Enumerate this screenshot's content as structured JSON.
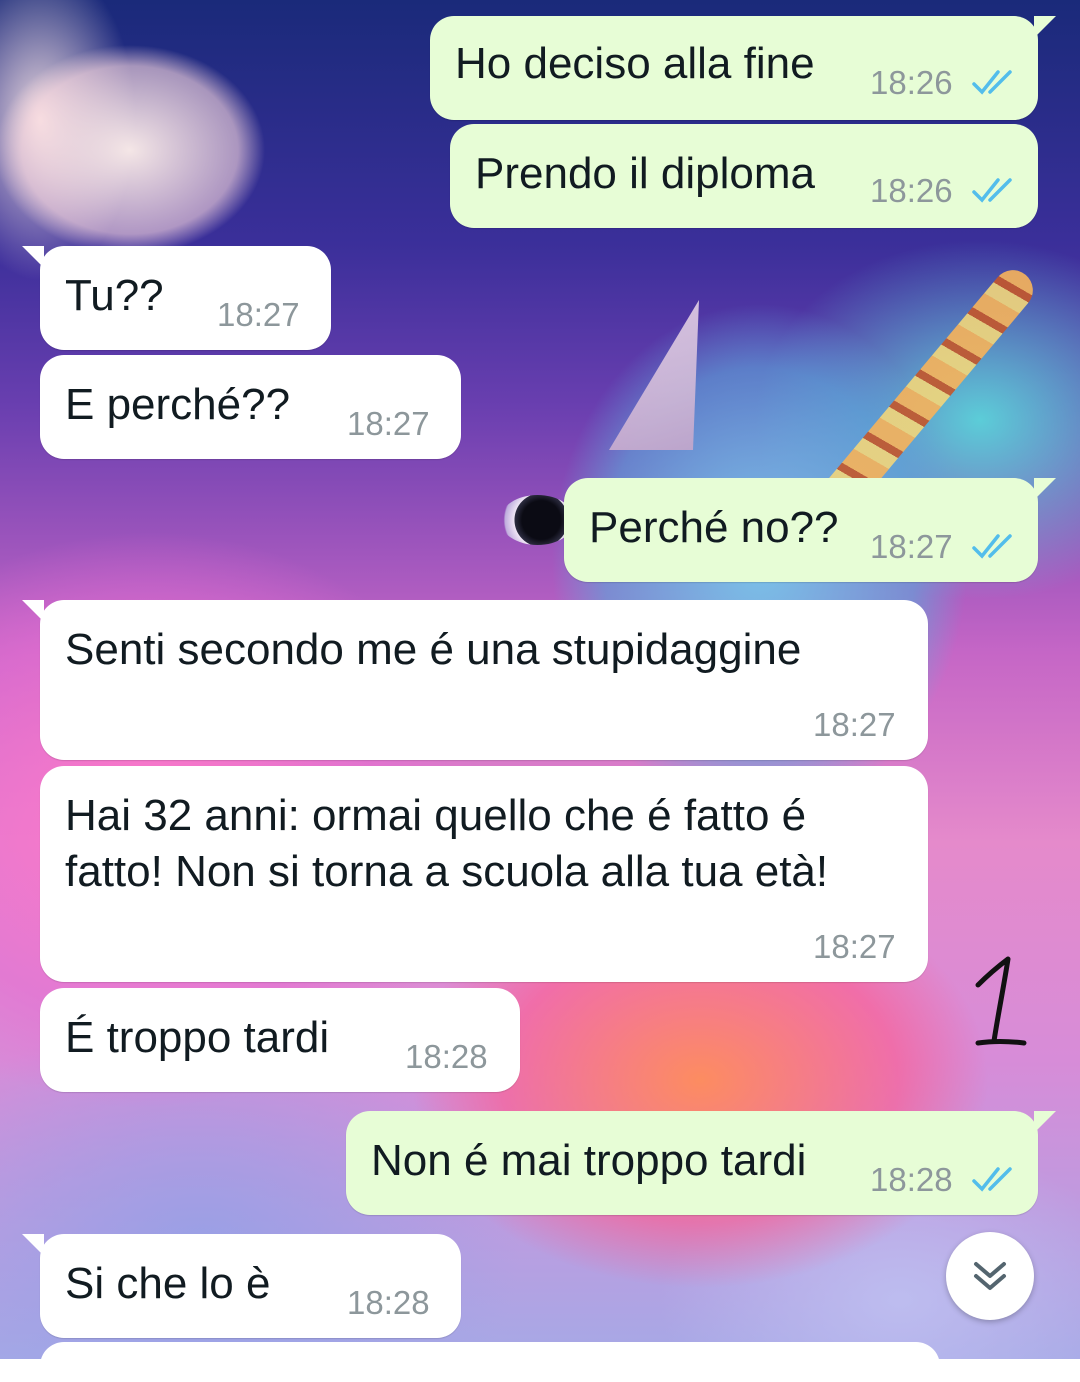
{
  "messages": [
    {
      "dir": "out",
      "text": "Ho deciso alla fine",
      "time": "18:26",
      "read": true
    },
    {
      "dir": "out",
      "text": "Prendo il diploma",
      "time": "18:26",
      "read": true
    },
    {
      "dir": "in",
      "text": "Tu??",
      "time": "18:27"
    },
    {
      "dir": "in",
      "text": "E perché??",
      "time": "18:27"
    },
    {
      "dir": "out",
      "text": "Perché no??",
      "time": "18:27",
      "read": true
    },
    {
      "dir": "in",
      "text": "Senti secondo me é una stupidaggine",
      "time": "18:27"
    },
    {
      "dir": "in",
      "text_line1": "Hai 32 anni: ormai quello che é fatto é",
      "text_line2": "fatto! Non si torna a scuola alla tua età!",
      "time": "18:27"
    },
    {
      "dir": "in",
      "text": "É troppo tardi",
      "time": "18:28"
    },
    {
      "dir": "out",
      "text": "Non é mai troppo tardi",
      "time": "18:28",
      "read": true
    },
    {
      "dir": "in",
      "text": "Si che lo è",
      "time": "18:28"
    }
  ],
  "annotation": {
    "number": "1"
  },
  "colors": {
    "incoming_bubble": "#ffffff",
    "outgoing_bubble": "#e7fdd6",
    "read_ticks": "#53bdeb",
    "timestamp": "#8d979b"
  },
  "icons": {
    "read_receipt": "double-check-icon",
    "scroll_down": "double-chevron-down-icon"
  }
}
